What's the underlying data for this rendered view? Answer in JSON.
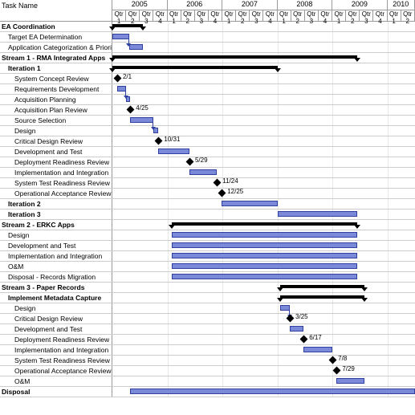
{
  "header": {
    "taskname_label": "Task Name"
  },
  "years": [
    {
      "label": "2005",
      "qtrs": 4
    },
    {
      "label": "2006",
      "qtrs": 4
    },
    {
      "label": "2007",
      "qtrs": 4
    },
    {
      "label": "2008",
      "qtrs": 4
    },
    {
      "label": "2009",
      "qtrs": 4
    },
    {
      "label": "2010",
      "qtrs": 2
    }
  ],
  "qtr_labels": [
    "Qtr 1",
    "Qtr 2",
    "Qtr 3",
    "Qtr 4",
    "Qtr 1",
    "Qtr 2",
    "Qtr 3",
    "Qtr 4",
    "Qtr 1",
    "Qtr 2",
    "Qtr 3",
    "Qtr 4",
    "Qtr 1",
    "Qtr 2",
    "Qtr 3",
    "Qtr 4",
    "Qtr 1",
    "Qtr 2",
    "Qtr 3",
    "Qtr 4",
    "Qtr 1",
    "Qtr 2"
  ],
  "tasks": [
    {
      "name": "EA Coordination",
      "indent": 0,
      "bold": true,
      "type": "summary",
      "start": 0,
      "end": 2.2
    },
    {
      "name": "Target EA Determination",
      "indent": 1,
      "bold": false,
      "type": "bar",
      "start": 0,
      "end": 1.2,
      "arrow_to_next": true
    },
    {
      "name": "Application Categorization & Prioritization",
      "indent": 1,
      "bold": false,
      "type": "bar",
      "start": 1.2,
      "end": 2.2
    },
    {
      "name": "Stream 1 - RMA Integrated Apps",
      "indent": 0,
      "bold": true,
      "type": "summary",
      "start": 0,
      "end": 17.8
    },
    {
      "name": "Iteration 1",
      "indent": 1,
      "bold": true,
      "type": "summary",
      "start": 0,
      "end": 12.0
    },
    {
      "name": "System Concept Review",
      "indent": 2,
      "bold": false,
      "type": "milestone",
      "at": 0.35,
      "label": "2/1"
    },
    {
      "name": "Requirements Development",
      "indent": 2,
      "bold": false,
      "type": "bar",
      "start": 0.35,
      "end": 1.0,
      "arrow_to_next": true
    },
    {
      "name": "Acquisition Planning",
      "indent": 2,
      "bold": false,
      "type": "bar",
      "start": 1.0,
      "end": 1.3
    },
    {
      "name": "Acquisition Plan Review",
      "indent": 2,
      "bold": false,
      "type": "milestone",
      "at": 1.3,
      "label": "4/25"
    },
    {
      "name": "Source Selection",
      "indent": 2,
      "bold": false,
      "type": "bar",
      "start": 1.3,
      "end": 3.0,
      "arrow_to_next": true
    },
    {
      "name": "Design",
      "indent": 2,
      "bold": false,
      "type": "bar",
      "start": 3.0,
      "end": 3.35
    },
    {
      "name": "Critical Design Review",
      "indent": 2,
      "bold": false,
      "type": "milestone",
      "at": 3.35,
      "label": "10/31"
    },
    {
      "name": "Development and Test",
      "indent": 2,
      "bold": false,
      "type": "bar",
      "start": 3.35,
      "end": 5.6
    },
    {
      "name": "Deployment Readiness Review",
      "indent": 2,
      "bold": false,
      "type": "milestone",
      "at": 5.6,
      "label": "5/29"
    },
    {
      "name": "Implementation and Integration",
      "indent": 2,
      "bold": false,
      "type": "bar",
      "start": 5.6,
      "end": 7.6
    },
    {
      "name": "System Test Readiness Review",
      "indent": 2,
      "bold": false,
      "type": "milestone",
      "at": 7.6,
      "label": "11/24"
    },
    {
      "name": "Operational Acceptance Review",
      "indent": 2,
      "bold": false,
      "type": "milestone",
      "at": 7.95,
      "label": "12/25"
    },
    {
      "name": "Iteration 2",
      "indent": 1,
      "bold": true,
      "type": "bar",
      "start": 7.95,
      "end": 12.0
    },
    {
      "name": "Iteration 3",
      "indent": 1,
      "bold": true,
      "type": "bar",
      "start": 12.0,
      "end": 17.8
    },
    {
      "name": "Stream 2 - ERKC Apps",
      "indent": 0,
      "bold": true,
      "type": "summary",
      "start": 4.3,
      "end": 17.8
    },
    {
      "name": "Design",
      "indent": 1,
      "bold": false,
      "type": "bar",
      "start": 4.3,
      "end": 17.8
    },
    {
      "name": "Development and Test",
      "indent": 1,
      "bold": false,
      "type": "bar",
      "start": 4.3,
      "end": 17.8
    },
    {
      "name": "Implementation and Integration",
      "indent": 1,
      "bold": false,
      "type": "bar",
      "start": 4.3,
      "end": 17.8
    },
    {
      "name": "O&M",
      "indent": 1,
      "bold": false,
      "type": "bar",
      "start": 4.3,
      "end": 17.8
    },
    {
      "name": "Disposal - Records Migration",
      "indent": 1,
      "bold": false,
      "type": "bar",
      "start": 4.3,
      "end": 17.8
    },
    {
      "name": "Stream 3 - Paper Records",
      "indent": 0,
      "bold": true,
      "type": "summary",
      "start": 12.2,
      "end": 18.3
    },
    {
      "name": "Implement Metadata Capture",
      "indent": 1,
      "bold": true,
      "type": "summary",
      "start": 12.2,
      "end": 18.3
    },
    {
      "name": "Design",
      "indent": 2,
      "bold": false,
      "type": "bar",
      "start": 12.2,
      "end": 12.9,
      "arrow_to_next": true
    },
    {
      "name": "Critical Design Review",
      "indent": 2,
      "bold": false,
      "type": "milestone",
      "at": 12.9,
      "label": "3/25"
    },
    {
      "name": "Development and Test",
      "indent": 2,
      "bold": false,
      "type": "bar",
      "start": 12.9,
      "end": 13.9
    },
    {
      "name": "Deployment Readiness Review",
      "indent": 2,
      "bold": false,
      "type": "milestone",
      "at": 13.9,
      "label": "6/17"
    },
    {
      "name": "Implementation and Integration",
      "indent": 2,
      "bold": false,
      "type": "bar",
      "start": 13.9,
      "end": 16.0
    },
    {
      "name": "System Test Readiness Review",
      "indent": 2,
      "bold": false,
      "type": "milestone",
      "at": 16.0,
      "label": "7/8"
    },
    {
      "name": "Operational Acceptance Review",
      "indent": 2,
      "bold": false,
      "type": "milestone",
      "at": 16.3,
      "label": "7/29"
    },
    {
      "name": "O&M",
      "indent": 2,
      "bold": false,
      "type": "bar",
      "start": 16.3,
      "end": 18.3
    },
    {
      "name": "Disposal",
      "indent": 0,
      "bold": true,
      "type": "bar",
      "start": 1.3,
      "end": 22.0
    }
  ],
  "chart_data": {
    "type": "bar",
    "title": "",
    "xlabel": "",
    "ylabel": "Task Name",
    "x_axis": {
      "type": "time",
      "unit": "quarter",
      "start": "2005-Q1",
      "end": "2010-Q2"
    },
    "categories": [
      "2005 Q1",
      "2005 Q2",
      "2005 Q3",
      "2005 Q4",
      "2006 Q1",
      "2006 Q2",
      "2006 Q3",
      "2006 Q4",
      "2007 Q1",
      "2007 Q2",
      "2007 Q3",
      "2007 Q4",
      "2008 Q1",
      "2008 Q2",
      "2008 Q3",
      "2008 Q4",
      "2009 Q1",
      "2009 Q2",
      "2009 Q3",
      "2009 Q4",
      "2010 Q1",
      "2010 Q2"
    ],
    "series": [
      {
        "name": "EA Coordination",
        "kind": "summary",
        "start_q": 0,
        "end_q": 2.2
      },
      {
        "name": "Target EA Determination",
        "kind": "task",
        "start_q": 0,
        "end_q": 1.2
      },
      {
        "name": "Application Categorization & Prioritization",
        "kind": "task",
        "start_q": 1.2,
        "end_q": 2.2
      },
      {
        "name": "Stream 1 - RMA Integrated Apps",
        "kind": "summary",
        "start_q": 0,
        "end_q": 17.8
      },
      {
        "name": "Iteration 1",
        "kind": "summary",
        "start_q": 0,
        "end_q": 12.0
      },
      {
        "name": "System Concept Review",
        "kind": "milestone",
        "at_q": 0.35,
        "date_label": "2/1"
      },
      {
        "name": "Requirements Development",
        "kind": "task",
        "start_q": 0.35,
        "end_q": 1.0
      },
      {
        "name": "Acquisition Planning",
        "kind": "task",
        "start_q": 1.0,
        "end_q": 1.3
      },
      {
        "name": "Acquisition Plan Review",
        "kind": "milestone",
        "at_q": 1.3,
        "date_label": "4/25"
      },
      {
        "name": "Source Selection",
        "kind": "task",
        "start_q": 1.3,
        "end_q": 3.0
      },
      {
        "name": "Design",
        "kind": "task",
        "start_q": 3.0,
        "end_q": 3.35
      },
      {
        "name": "Critical Design Review",
        "kind": "milestone",
        "at_q": 3.35,
        "date_label": "10/31"
      },
      {
        "name": "Development and Test",
        "kind": "task",
        "start_q": 3.35,
        "end_q": 5.6
      },
      {
        "name": "Deployment Readiness Review",
        "kind": "milestone",
        "at_q": 5.6,
        "date_label": "5/29"
      },
      {
        "name": "Implementation and Integration",
        "kind": "task",
        "start_q": 5.6,
        "end_q": 7.6
      },
      {
        "name": "System Test Readiness Review",
        "kind": "milestone",
        "at_q": 7.6,
        "date_label": "11/24"
      },
      {
        "name": "Operational Acceptance Review",
        "kind": "milestone",
        "at_q": 7.95,
        "date_label": "12/25"
      },
      {
        "name": "Iteration 2",
        "kind": "task",
        "start_q": 7.95,
        "end_q": 12.0
      },
      {
        "name": "Iteration 3",
        "kind": "task",
        "start_q": 12.0,
        "end_q": 17.8
      },
      {
        "name": "Stream 2 - ERKC Apps",
        "kind": "summary",
        "start_q": 4.3,
        "end_q": 17.8
      },
      {
        "name": "Design (ERKC)",
        "kind": "task",
        "start_q": 4.3,
        "end_q": 17.8
      },
      {
        "name": "Development and Test (ERKC)",
        "kind": "task",
        "start_q": 4.3,
        "end_q": 17.8
      },
      {
        "name": "Implementation and Integration (ERKC)",
        "kind": "task",
        "start_q": 4.3,
        "end_q": 17.8
      },
      {
        "name": "O&M (ERKC)",
        "kind": "task",
        "start_q": 4.3,
        "end_q": 17.8
      },
      {
        "name": "Disposal - Records Migration",
        "kind": "task",
        "start_q": 4.3,
        "end_q": 17.8
      },
      {
        "name": "Stream 3 - Paper Records",
        "kind": "summary",
        "start_q": 12.2,
        "end_q": 18.3
      },
      {
        "name": "Implement Metadata Capture",
        "kind": "summary",
        "start_q": 12.2,
        "end_q": 18.3
      },
      {
        "name": "Design (Paper)",
        "kind": "task",
        "start_q": 12.2,
        "end_q": 12.9
      },
      {
        "name": "Critical Design Review (Paper)",
        "kind": "milestone",
        "at_q": 12.9,
        "date_label": "3/25"
      },
      {
        "name": "Development and Test (Paper)",
        "kind": "task",
        "start_q": 12.9,
        "end_q": 13.9
      },
      {
        "name": "Deployment Readiness Review (Paper)",
        "kind": "milestone",
        "at_q": 13.9,
        "date_label": "6/17"
      },
      {
        "name": "Implementation and Integration (Paper)",
        "kind": "task",
        "start_q": 13.9,
        "end_q": 16.0
      },
      {
        "name": "System Test Readiness Review (Paper)",
        "kind": "milestone",
        "at_q": 16.0,
        "date_label": "7/8"
      },
      {
        "name": "Operational Acceptance Review (Paper)",
        "kind": "milestone",
        "at_q": 16.3,
        "date_label": "7/29"
      },
      {
        "name": "O&M (Paper)",
        "kind": "task",
        "start_q": 16.3,
        "end_q": 18.3
      },
      {
        "name": "Disposal",
        "kind": "task",
        "start_q": 1.3,
        "end_q": 22.0
      }
    ]
  }
}
